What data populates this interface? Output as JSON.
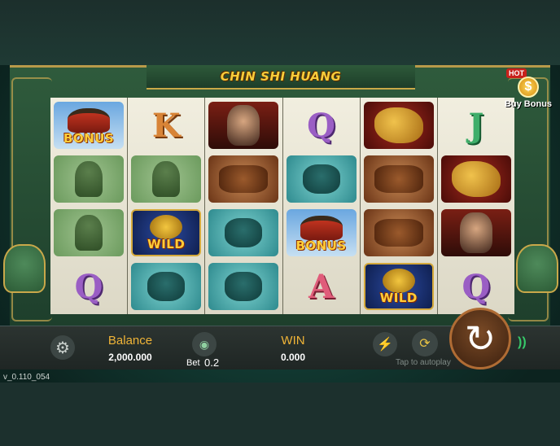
{
  "game": {
    "title": "CHIN SHI HUANG"
  },
  "buy_bonus": {
    "hot_label": "HOT",
    "coin_symbol": "$",
    "label": "Buy Bonus"
  },
  "reels": [
    [
      "bonus",
      "soldier",
      "soldier",
      "Q"
    ],
    [
      "K",
      "soldier",
      "wild",
      "lion"
    ],
    [
      "emperor",
      "horse",
      "lion",
      "lion"
    ],
    [
      "Q",
      "lion",
      "bonus",
      "A"
    ],
    [
      "dragon",
      "horse",
      "horse",
      "wild"
    ],
    [
      "J",
      "dragon",
      "emperor",
      "Q"
    ]
  ],
  "symbol_labels": {
    "bonus": "BONUS",
    "wild": "WILD"
  },
  "bottom_bar": {
    "balance_label": "Balance",
    "balance_value": "2,000.000",
    "bet_label": "Bet",
    "bet_value": "0.2",
    "win_label": "WIN",
    "win_value": "0.000",
    "autoplay_hint": "Tap to autoplay"
  },
  "icons": {
    "settings": "gear-icon",
    "bet": "chips-icon",
    "turbo": "lightning-icon",
    "autoplay": "autoplay-icon",
    "spin": "spin-icon",
    "signal": "wifi-icon"
  },
  "version": "v_0.110_054",
  "colors": {
    "accent_gold": "#f0b437",
    "title_gold": "#f6cd3a",
    "wifi_green": "#37c96a"
  }
}
